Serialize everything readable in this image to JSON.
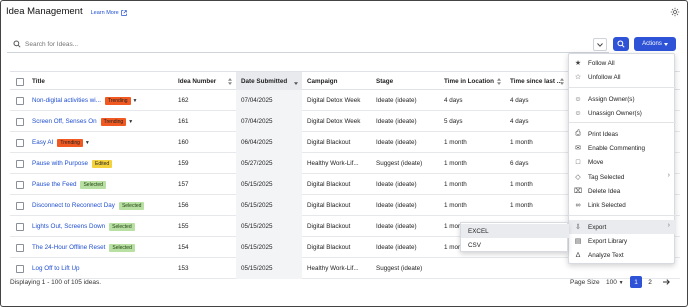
{
  "header": {
    "title": "Idea Management",
    "learn_more": "Learn More"
  },
  "search": {
    "placeholder": "Search for Ideas..."
  },
  "actions_label": "Actions",
  "columns": [
    "Title",
    "Idea Number",
    "Date Submitted",
    "Campaign",
    "Stage",
    "Time in Location",
    "Time since last ..."
  ],
  "rows": [
    {
      "title": "Non-digital activities wi...",
      "badge": "Trending",
      "badge_type": "trending",
      "caret": true,
      "number": "162",
      "date": "07/04/2025",
      "campaign": "Digital Detox Week",
      "stage": "Ideate (ideate)",
      "tloc": "4 days",
      "tlast": "4 days"
    },
    {
      "title": "Screen Off, Senses On",
      "badge": "Trending",
      "badge_type": "trending",
      "caret": true,
      "number": "161",
      "date": "07/04/2025",
      "campaign": "Digital Detox Week",
      "stage": "Ideate (ideate)",
      "tloc": "5 days",
      "tlast": "4 days"
    },
    {
      "title": "Easy AI",
      "badge": "Trending",
      "badge_type": "trending",
      "caret": true,
      "number": "160",
      "date": "06/04/2025",
      "campaign": "Digital Blackout",
      "stage": "Ideate (ideate)",
      "tloc": "1 month",
      "tlast": "1 month"
    },
    {
      "title": "Pause with Purpose",
      "badge": "Edited",
      "badge_type": "edited",
      "caret": false,
      "number": "159",
      "date": "05/27/2025",
      "campaign": "Healthy Work-Lif...",
      "stage": "Suggest (ideate)",
      "tloc": "1 month",
      "tlast": "6 days"
    },
    {
      "title": "Pause the Feed",
      "badge": "Selected",
      "badge_type": "selected",
      "caret": false,
      "number": "157",
      "date": "05/15/2025",
      "campaign": "Digital Blackout",
      "stage": "Ideate (ideate)",
      "tloc": "1 month",
      "tlast": "1 month"
    },
    {
      "title": "Disconnect to Reconnect Day",
      "badge": "Selected",
      "badge_type": "selected",
      "caret": false,
      "number": "156",
      "date": "05/15/2025",
      "campaign": "Digital Blackout",
      "stage": "Ideate (ideate)",
      "tloc": "1 month",
      "tlast": "1 month"
    },
    {
      "title": "Lights Out, Screens Down",
      "badge": "Selected",
      "badge_type": "selected",
      "caret": false,
      "number": "155",
      "date": "05/15/2025",
      "campaign": "Digital Blackout",
      "stage": "Ideate (ideate)",
      "tloc": "1 month",
      "tlast": ""
    },
    {
      "title": "The 24-Hour Offline Reset",
      "badge": "Selected",
      "badge_type": "selected",
      "caret": false,
      "number": "154",
      "date": "05/15/2025",
      "campaign": "Digital Blackout",
      "stage": "Ideate (ideate)",
      "tloc": "1 month",
      "tlast": ""
    },
    {
      "title": "Log Off to Lift Up",
      "badge": "",
      "badge_type": "",
      "caret": false,
      "number": "153",
      "date": "05/15/2025",
      "campaign": "Healthy Work-Lif...",
      "stage": "Suggest (ideate)",
      "tloc": "",
      "tlast": ""
    }
  ],
  "footer": {
    "displaying": "Displaying 1 - 100 of 105 ideas.",
    "page_size_label": "Page Size",
    "page_size": "100",
    "pages": [
      "1",
      "2"
    ]
  },
  "actions_menu": [
    {
      "label": "Follow All",
      "icon": "star-icon"
    },
    {
      "label": "Unfollow All",
      "icon": "star-outline-icon"
    },
    {
      "label": "Assign Owner(s)",
      "icon": "user-add-icon"
    },
    {
      "label": "Unassign Owner(s)",
      "icon": "user-remove-icon"
    },
    {
      "label": "Print Ideas",
      "icon": "print-icon"
    },
    {
      "label": "Enable Commenting",
      "icon": "comment-icon"
    },
    {
      "label": "Move",
      "icon": "folder-icon"
    },
    {
      "label": "Tag Selected",
      "icon": "tag-icon",
      "sub": true
    },
    {
      "label": "Delete Idea",
      "icon": "trash-icon"
    },
    {
      "label": "Link Selected",
      "icon": "link-icon"
    },
    {
      "label": "Export",
      "icon": "export-icon",
      "sub": true,
      "highlighted": true
    },
    {
      "label": "Export Library",
      "icon": "export-library-icon"
    },
    {
      "label": "Analyze Text",
      "icon": "analyze-icon"
    }
  ],
  "export_submenu": [
    {
      "label": "EXCEL",
      "highlighted": true
    },
    {
      "label": "CSV"
    }
  ]
}
